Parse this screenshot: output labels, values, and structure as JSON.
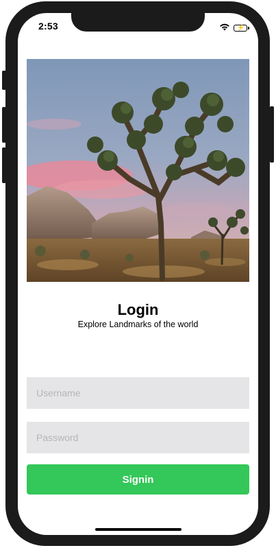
{
  "status_bar": {
    "time": "2:53",
    "wifi_icon": "wifi-icon",
    "battery_icon": "battery-charging-icon",
    "battery_color": "#31c548"
  },
  "hero_image": {
    "description": "desert-landmark-photo",
    "sky_color": "#8aa3bf",
    "ground_color": "#7a5a34"
  },
  "header": {
    "title": "Login",
    "subtitle": "Explore Landmarks of the world"
  },
  "form": {
    "username_placeholder": "Username",
    "username_value": "",
    "password_placeholder": "Password",
    "password_value": "",
    "signin_label": "Signin"
  },
  "colors": {
    "accent": "#34c759",
    "field_bg": "#e5e5e7",
    "placeholder": "#b5b5b8"
  }
}
